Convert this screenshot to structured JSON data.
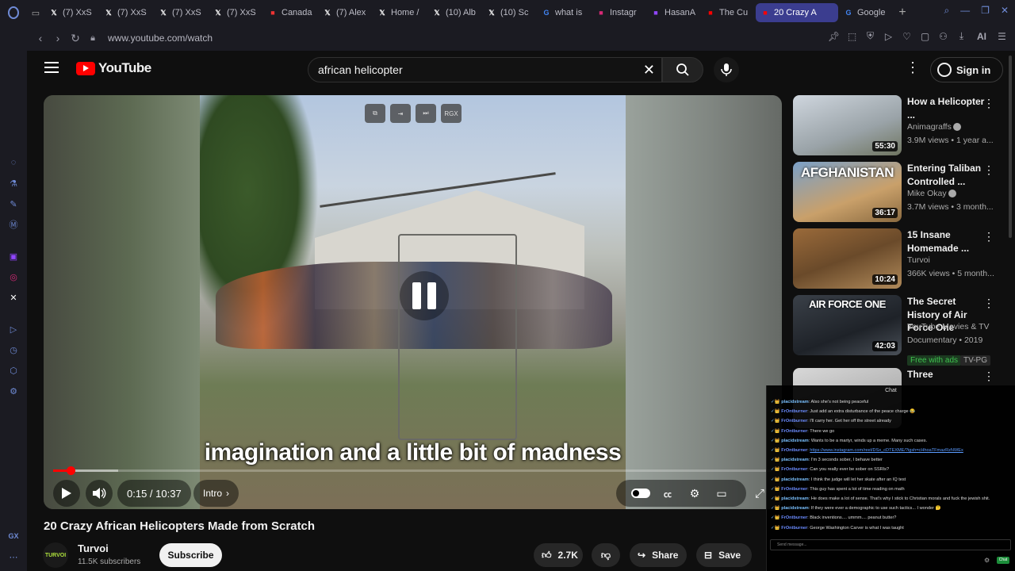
{
  "browser": {
    "tabs": [
      {
        "label": "(7) XxS",
        "icon": "x-icon",
        "color": "#ffffff"
      },
      {
        "label": "(7) XxS",
        "icon": "x-icon",
        "color": "#ffffff"
      },
      {
        "label": "(7) XxS",
        "icon": "x-icon",
        "color": "#ffffff"
      },
      {
        "label": "(7) XxS",
        "icon": "x-icon",
        "color": "#ffffff"
      },
      {
        "label": "Canada",
        "icon": "canada-icon",
        "color": "#e33"
      },
      {
        "label": "(7) Alex",
        "icon": "x-icon",
        "color": "#ffffff"
      },
      {
        "label": "Home /",
        "icon": "x-icon",
        "color": "#ffffff"
      },
      {
        "label": "(10) Alb",
        "icon": "x-icon",
        "color": "#ffffff"
      },
      {
        "label": "(10) Sc",
        "icon": "x-icon",
        "color": "#ffffff"
      },
      {
        "label": "what is",
        "icon": "google-icon",
        "color": "#4285f4"
      },
      {
        "label": "Instagr",
        "icon": "instagram-icon",
        "color": "#d62976"
      },
      {
        "label": "HasanA",
        "icon": "twitch-icon",
        "color": "#9146ff"
      },
      {
        "label": "The Cu",
        "icon": "youtube-icon",
        "color": "#ff0000"
      },
      {
        "label": "20 Crazy A",
        "icon": "youtube-icon",
        "color": "#ff0000",
        "active": true
      },
      {
        "label": "Google",
        "icon": "google-icon",
        "color": "#4285f4"
      }
    ],
    "url": "www.youtube.com/watch",
    "addr_ai": "AI",
    "sidebar_bottom": "GX"
  },
  "youtube": {
    "logo_text": "YouTube",
    "search_value": "african helicopter",
    "signin_label": "Sign in",
    "player": {
      "subtitle": "imagination and a little bit of madness",
      "time": "0:15 / 10:37",
      "chapter": "Intro",
      "progress": 0.024,
      "buffered": 0.09,
      "extension_label": "RGX"
    },
    "video_title": "20 Crazy African Helicopters Made from Scratch",
    "channel": {
      "name": "Turvoi",
      "subs": "11.5K subscribers",
      "avatar_text": "TURVOI"
    },
    "subscribe_label": "Subscribe",
    "likes": "2.7K",
    "share_label": "Share",
    "save_label": "Save",
    "recommendations": [
      {
        "title": "How a Helicopter ...",
        "channel": "Animagraffs",
        "verified": true,
        "meta": "3.9M views • 1 year a...",
        "duration": "55:30",
        "thumb": "linear-gradient(160deg,#cfd6de,#9aa3a8 60%,#6f7560)"
      },
      {
        "title": "Entering Taliban Controlled ...",
        "channel": "Mike Okay",
        "verified": true,
        "meta": "3.7M views • 3 month...",
        "duration": "36:17",
        "thumb": "linear-gradient(160deg,#7aa0c8,#c9a06a 60%,#8a6a40)",
        "thumb_text": "AFGHANISTAN"
      },
      {
        "title": "15 Insane Homemade ...",
        "channel": "Turvoi",
        "verified": false,
        "meta": "366K views • 5 month...",
        "duration": "10:24",
        "thumb": "linear-gradient(160deg,#9a6a3a,#6a4a2a 50%,#b08a5a)"
      },
      {
        "title": "The Secret History of Air Force One",
        "channel": "YouTube Movies & TV",
        "verified": false,
        "meta": "Documentary • 2019",
        "duration": "42:03",
        "thumb": "linear-gradient(160deg,#3a4048,#1e2228 60%,#4a5058)",
        "thumb_text": "AIR FORCE ONE",
        "badge": "Free with ads",
        "badge2": "TV-PG"
      },
      {
        "title": "Three",
        "channel": "",
        "verified": false,
        "meta": "",
        "duration": "",
        "thumb": "linear-gradient(160deg,#d8d8d8,#9a9a9a)"
      }
    ]
  },
  "chat": {
    "title": "Chat",
    "input_placeholder": "Send message...",
    "send_label": "Chat",
    "lines": [
      {
        "user": "placidstream",
        "ucls": "u1",
        "msg": "Also she's not being peaceful"
      },
      {
        "user": "FrOntburner",
        "ucls": "u2",
        "msg": "Just add an extra disturbance of the peace charge 😂"
      },
      {
        "user": "FrOntburner",
        "ucls": "u2",
        "msg": "I'll carry her. Get her off the street already"
      },
      {
        "user": "FrOntburner",
        "ucls": "u2",
        "msg": "There we go"
      },
      {
        "user": "placidstream",
        "ucls": "u1",
        "msg": "Wants to be a martyr, winds up a meme. Many such cases."
      },
      {
        "user": "FrOntburner",
        "ucls": "u2",
        "msg": "",
        "link": "https://www.instagram.com/reel/DSx_cDTEXME/?igsh=cHhoaTFmazRzNWEx"
      },
      {
        "user": "placidstream",
        "ucls": "u1",
        "msg": "I'm 3 seconds sober, I behave better"
      },
      {
        "user": "FrOntburner",
        "ucls": "u2",
        "msg": "Can you really ever be sober on SSRIs?"
      },
      {
        "user": "placidstream",
        "ucls": "u1",
        "msg": "I think the judge will let her skate after an IQ test"
      },
      {
        "user": "FrOntburner",
        "ucls": "u2",
        "msg": "This guy has spent a lot of time reading on math"
      },
      {
        "user": "placidstream",
        "ucls": "u1",
        "msg": "He does make a lot of sense. That's why I stick to Christian morals and fuck the jewish shit."
      },
      {
        "user": "placidstream",
        "ucls": "u1",
        "msg": "If they were ever a demographic to use such tactics... I wonder 🤔"
      },
      {
        "user": "FrOntburner",
        "ucls": "u2",
        "msg": "Black inventions.... ummm.... peanut butter?"
      },
      {
        "user": "FrOntburner",
        "ucls": "u2",
        "msg": "George Washington Carver is what I was taught"
      }
    ]
  }
}
